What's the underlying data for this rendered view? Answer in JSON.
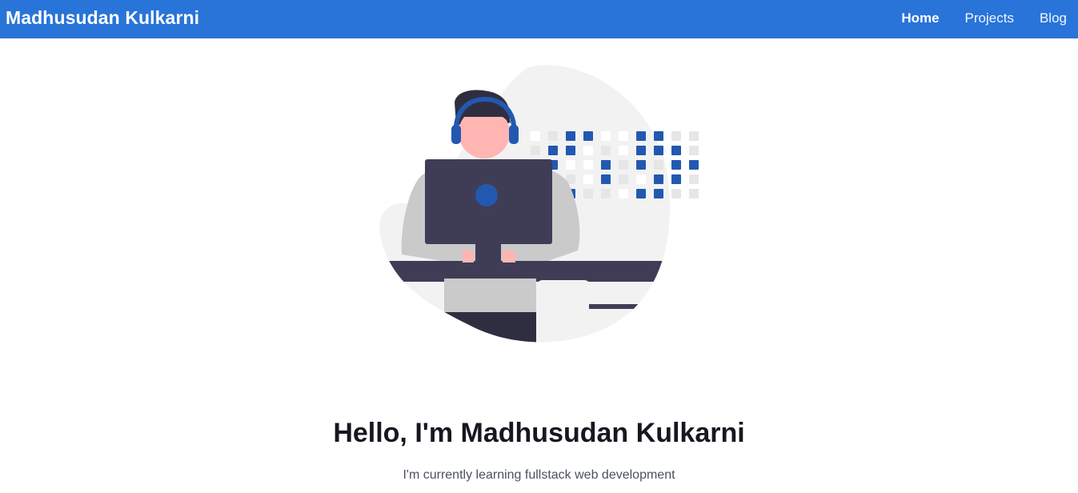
{
  "navbar": {
    "brand": "Madhusudan Kulkarni",
    "links": [
      {
        "label": "Home",
        "active": true
      },
      {
        "label": "Projects",
        "active": false
      },
      {
        "label": "Blog",
        "active": false
      }
    ],
    "background_color": "#2874d9"
  },
  "hero": {
    "illustration_name": "developer-at-computer-illustration",
    "title": "Hello, I'm Madhusudan Kulkarni",
    "subtitle": "I'm currently learning fullstack web development"
  },
  "colors": {
    "accent_blue": "#2358b0",
    "monitor_dark": "#3f3d56",
    "skin": "#ffb6b3",
    "blob_gray": "#f2f2f2"
  }
}
